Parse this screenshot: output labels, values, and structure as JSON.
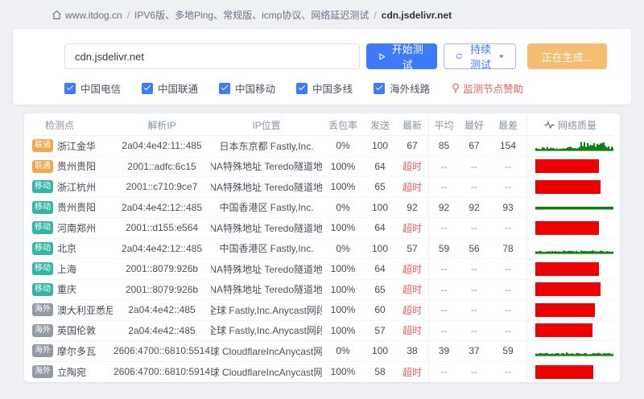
{
  "breadcrumb": {
    "home": "www.itdog.cn",
    "separator": "/",
    "path": "IPV6版、多地Ping、常规版、icmp协议、网络延迟测试",
    "current": "cdn.jsdelivr.net"
  },
  "test_panel": {
    "input_value": "cdn.jsdelivr.net",
    "start_button": "开始测试",
    "continuous_button": "持续测试",
    "generating_button": "正在生成...",
    "checkboxes": [
      {
        "label": "中国电信",
        "checked": true
      },
      {
        "label": "中国联通",
        "checked": true
      },
      {
        "label": "中国移动",
        "checked": true
      },
      {
        "label": "中国多线",
        "checked": true
      },
      {
        "label": "海外线路",
        "checked": true
      }
    ],
    "sponsor_link": "监测节点赞助"
  },
  "table": {
    "headers": [
      "检测点",
      "解析IP",
      "IP位置",
      "丢包率",
      "发送",
      "最新",
      "平均",
      "最好",
      "最差",
      "网络质量"
    ],
    "rows": [
      {
        "isp": "联通",
        "isp_type": "unicom",
        "city": "浙江金华",
        "ip": "2a04:4e42:11::485",
        "location": "日本东京都 Fastly,Inc.",
        "loss": "0%",
        "sent": "100",
        "latest": "67",
        "avg": "85",
        "best": "67",
        "worst": "154",
        "timeout": false,
        "quality": "spiky"
      },
      {
        "isp": "联通",
        "isp_type": "unicom",
        "city": "贵州贵阳",
        "ip": "2001::adfc:6c15",
        "location": "IANA特殊地址 Teredo隧道地址",
        "loss": "100%",
        "sent": "64",
        "latest": "超时",
        "avg": "--",
        "best": "--",
        "worst": "--",
        "timeout": true,
        "quality": "timeout"
      },
      {
        "isp": "移动",
        "isp_type": "mobile",
        "city": "浙江杭州",
        "ip": "2001::c710:9ce7",
        "location": "IANA特殊地址 Teredo隧道地址",
        "loss": "100%",
        "sent": "65",
        "latest": "超时",
        "avg": "--",
        "best": "--",
        "worst": "--",
        "timeout": true,
        "quality": "timeout"
      },
      {
        "isp": "移动",
        "isp_type": "mobile",
        "city": "贵州贵阳",
        "ip": "2a04:4e42:12::485",
        "location": "中国香港区 Fastly,Inc.",
        "loss": "0%",
        "sent": "100",
        "latest": "92",
        "avg": "92",
        "best": "92",
        "worst": "93",
        "timeout": false,
        "quality": "flat"
      },
      {
        "isp": "移动",
        "isp_type": "mobile",
        "city": "河南郑州",
        "ip": "2001::d155:e564",
        "location": "IANA特殊地址 Teredo隧道地址",
        "loss": "100%",
        "sent": "64",
        "latest": "超时",
        "avg": "--",
        "best": "--",
        "worst": "--",
        "timeout": true,
        "quality": "timeout"
      },
      {
        "isp": "移动",
        "isp_type": "mobile",
        "city": "北京",
        "ip": "2a04:4e42:12::485",
        "location": "中国香港区 Fastly,Inc.",
        "loss": "0%",
        "sent": "100",
        "latest": "57",
        "avg": "59",
        "best": "56",
        "worst": "78",
        "timeout": false,
        "quality": "bumps"
      },
      {
        "isp": "移动",
        "isp_type": "mobile",
        "city": "上海",
        "ip": "2001::8079:926b",
        "location": "IANA特殊地址 Teredo隧道地址",
        "loss": "100%",
        "sent": "64",
        "latest": "超时",
        "avg": "--",
        "best": "--",
        "worst": "--",
        "timeout": true,
        "quality": "timeout"
      },
      {
        "isp": "移动",
        "isp_type": "mobile",
        "city": "重庆",
        "ip": "2001::8079:926b",
        "location": "IANA特殊地址 Teredo隧道地址",
        "loss": "100%",
        "sent": "65",
        "latest": "超时",
        "avg": "--",
        "best": "--",
        "worst": "--",
        "timeout": true,
        "quality": "timeout"
      },
      {
        "isp": "海外",
        "isp_type": "overseas",
        "city": "澳大利亚悉尼",
        "ip": "2a04:4e42::485",
        "location": "全球 Fastly,Inc.Anycast网段",
        "loss": "100%",
        "sent": "60",
        "latest": "超时",
        "avg": "--",
        "best": "--",
        "worst": "--",
        "timeout": true,
        "quality": "timeout"
      },
      {
        "isp": "海外",
        "isp_type": "overseas",
        "city": "英国伦敦",
        "ip": "2a04:4e42::485",
        "location": "全球 Fastly,Inc.Anycast网段",
        "loss": "100%",
        "sent": "57",
        "latest": "超时",
        "avg": "--",
        "best": "--",
        "worst": "--",
        "timeout": true,
        "quality": "timeout"
      },
      {
        "isp": "海外",
        "isp_type": "overseas",
        "city": "摩尔多瓦",
        "ip": "2606:4700::6810:5514",
        "location": "全球 CloudflareIncAnycast网段",
        "loss": "0%",
        "sent": "100",
        "latest": "38",
        "avg": "39",
        "best": "37",
        "worst": "59",
        "timeout": false,
        "quality": "bumps"
      },
      {
        "isp": "海外",
        "isp_type": "overseas",
        "city": "立陶宛",
        "ip": "2606:4700::6810:5914",
        "location": "全球 CloudflareIncAnycast网段",
        "loss": "100%",
        "sent": "58",
        "latest": "超时",
        "avg": "--",
        "best": "--",
        "worst": "--",
        "timeout": true,
        "quality": "timeout"
      }
    ]
  },
  "colors": {
    "accent": "#3e7bfa",
    "warning": "#f5bd72",
    "danger": "#f25c5c",
    "quality_green": "#108010",
    "quality_red": "#ee0000",
    "badge_unicom": "#f3a74a",
    "badge_mobile": "#35b5a2",
    "badge_overseas": "#939aa3"
  }
}
